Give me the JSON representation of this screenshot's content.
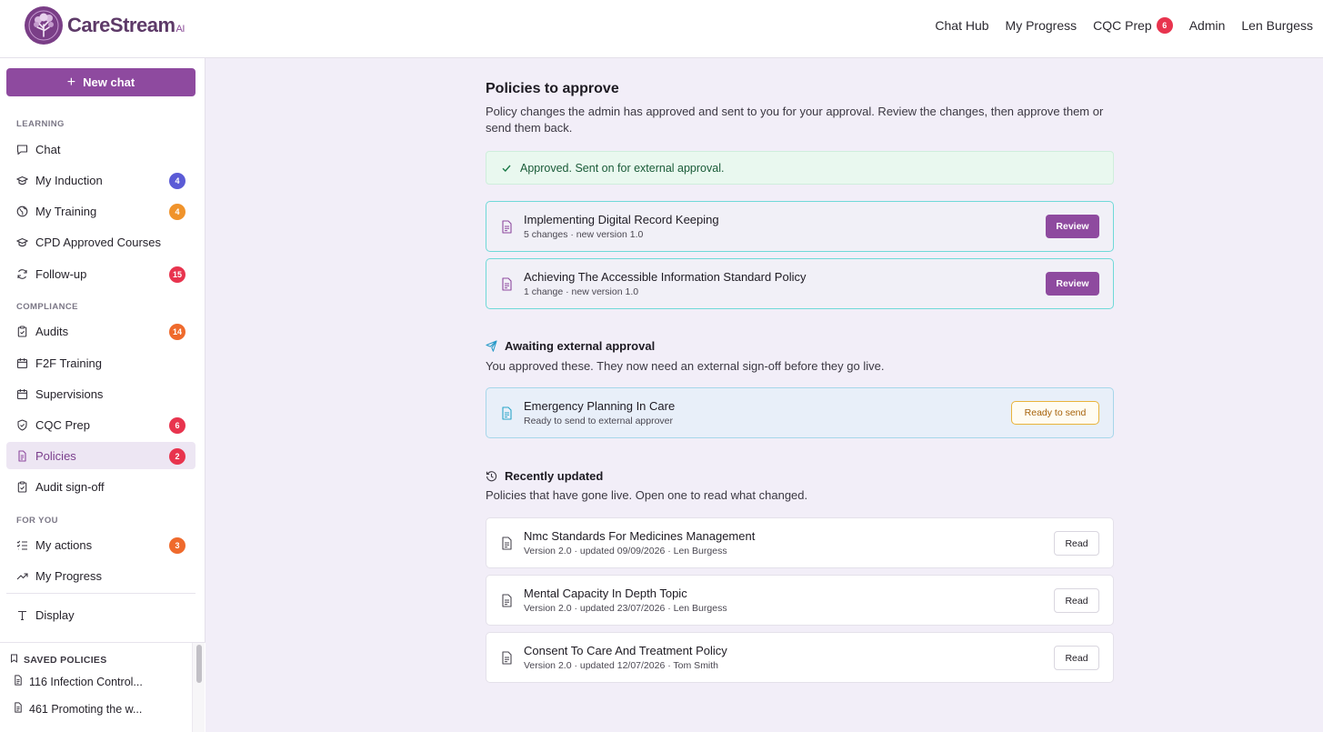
{
  "brand": {
    "name": "CareStream",
    "suffix": "AI"
  },
  "topnav": {
    "items": [
      {
        "label": "Chat Hub"
      },
      {
        "label": "My Progress"
      },
      {
        "label": "CQC Prep",
        "badge": "6"
      },
      {
        "label": "Admin"
      },
      {
        "label": "Len Burgess"
      }
    ]
  },
  "sidebar": {
    "new_chat_label": "New chat",
    "sections": {
      "learning": "LEARNING",
      "compliance": "COMPLIANCE",
      "for_you": "FOR YOU"
    },
    "items": {
      "chat": {
        "label": "Chat"
      },
      "induction": {
        "label": "My Induction",
        "badge": "4"
      },
      "training": {
        "label": "My Training",
        "badge": "4"
      },
      "cpd": {
        "label": "CPD Approved Courses"
      },
      "followup": {
        "label": "Follow-up",
        "badge": "15"
      },
      "audits": {
        "label": "Audits",
        "badge": "14"
      },
      "f2f": {
        "label": "F2F Training"
      },
      "supervisions": {
        "label": "Supervisions"
      },
      "cqc": {
        "label": "CQC Prep",
        "badge": "6"
      },
      "policies": {
        "label": "Policies",
        "badge": "2"
      },
      "audit_signoff": {
        "label": "Audit sign-off"
      },
      "actions": {
        "label": "My actions",
        "badge": "3"
      },
      "progress": {
        "label": "My Progress"
      },
      "display": {
        "label": "Display"
      }
    },
    "saved": {
      "label": "SAVED POLICIES",
      "items": [
        {
          "label": "116 Infection Control..."
        },
        {
          "label": "461 Promoting the w..."
        }
      ]
    }
  },
  "main": {
    "title": "Policies to approve",
    "description": "Policy changes the admin has approved and sent to you for your approval. Review the changes, then approve them or send them back.",
    "alert": "Approved. Sent on for external approval.",
    "pending": [
      {
        "title": "Implementing Digital Record Keeping",
        "sub": "5 changes · new version 1.0",
        "action": "Review"
      },
      {
        "title": "Achieving The Accessible Information Standard Policy",
        "sub": "1 change · new version 1.0",
        "action": "Review"
      }
    ],
    "external": {
      "title": "Awaiting external approval",
      "description": "You approved these. They now need an external sign-off before they go live.",
      "items": [
        {
          "title": "Emergency Planning In Care",
          "sub": "Ready to send to external approver",
          "action": "Ready to send"
        }
      ]
    },
    "recent": {
      "title": "Recently updated",
      "description": "Policies that have gone live. Open one to read what changed.",
      "items": [
        {
          "title": "Nmc Standards For Medicines Management",
          "sub": "Version 2.0 · updated 09/09/2026 · Len Burgess",
          "action": "Read"
        },
        {
          "title": "Mental Capacity In Depth Topic",
          "sub": "Version 2.0 · updated 23/07/2026 · Len Burgess",
          "action": "Read"
        },
        {
          "title": "Consent To Care And Treatment Policy",
          "sub": "Version 2.0 · updated 12/07/2026 · Tom Smith",
          "action": "Read"
        }
      ]
    }
  },
  "colors": {
    "brand_purple": "#8e4a9f",
    "badge_blue": "#5b5bd6",
    "badge_orange": "#f0932b",
    "badge_red": "#e8344e",
    "badge_deep_orange": "#ef6a2c"
  }
}
